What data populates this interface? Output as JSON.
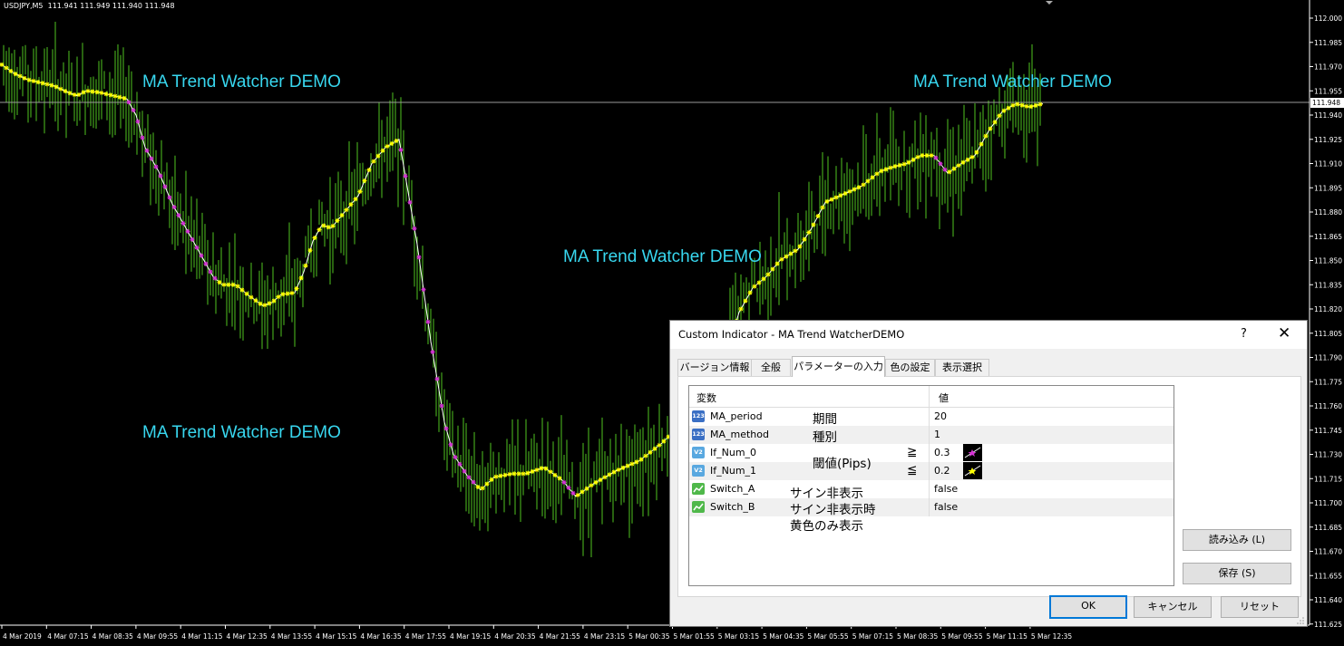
{
  "chart": {
    "symbol": "USDJPY,M5",
    "ohlc": "111.941 111.949 111.940 111.948",
    "current_price": "111.948",
    "price_ticks": [
      "112.000",
      "111.985",
      "111.970",
      "111.955",
      "111.940",
      "111.925",
      "111.910",
      "111.895",
      "111.880",
      "111.865",
      "111.850",
      "111.835",
      "111.820",
      "111.805",
      "111.790",
      "111.775",
      "111.760",
      "111.745",
      "111.730",
      "111.715",
      "111.700",
      "111.685",
      "111.670",
      "111.655",
      "111.640",
      "111.625"
    ],
    "time_ticks": [
      "4 Mar 2019",
      "4 Mar 07:15",
      "4 Mar 08:35",
      "4 Mar 09:55",
      "4 Mar 11:15",
      "4 Mar 12:35",
      "4 Mar 13:55",
      "4 Mar 15:15",
      "4 Mar 16:35",
      "4 Mar 17:55",
      "4 Mar 19:15",
      "4 Mar 20:35",
      "4 Mar 21:55",
      "4 Mar 23:15",
      "5 Mar 00:35",
      "5 Mar 01:55",
      "5 Mar 03:15",
      "5 Mar 04:35",
      "5 Mar 05:55",
      "5 Mar 07:15",
      "5 Mar 08:35",
      "5 Mar 09:55",
      "5 Mar 11:15",
      "5 Mar 12:35"
    ],
    "watermarks": [
      "MA Trend Watcher DEMO",
      "MA Trend Watcher DEMO",
      "MA Trend Watcher DEMO",
      "MA Trend Watcher DEMO"
    ],
    "colors": {
      "bars": "#4fc51f",
      "ma_line": "#ffffff",
      "ma_up_marker": "#ffff00",
      "ma_down_marker": "#d633d6",
      "watermark": "#38d7ef"
    },
    "ma_path": [
      [
        0,
        111.972
      ],
      [
        15,
        111.966
      ],
      [
        30,
        111.962
      ],
      [
        45,
        111.96
      ],
      [
        60,
        111.958
      ],
      [
        75,
        111.954
      ],
      [
        85,
        111.952
      ],
      [
        95,
        111.955
      ],
      [
        110,
        111.954
      ],
      [
        125,
        111.952
      ],
      [
        140,
        111.95
      ],
      [
        150,
        111.94
      ],
      [
        160,
        111.92
      ],
      [
        175,
        111.905
      ],
      [
        190,
        111.885
      ],
      [
        205,
        111.87
      ],
      [
        220,
        111.855
      ],
      [
        235,
        111.84
      ],
      [
        245,
        111.835
      ],
      [
        260,
        111.835
      ],
      [
        275,
        111.828
      ],
      [
        290,
        111.822
      ],
      [
        300,
        111.824
      ],
      [
        310,
        111.829
      ],
      [
        325,
        111.83
      ],
      [
        335,
        111.843
      ],
      [
        345,
        111.862
      ],
      [
        355,
        111.872
      ],
      [
        365,
        111.87
      ],
      [
        380,
        111.88
      ],
      [
        395,
        111.89
      ],
      [
        410,
        111.91
      ],
      [
        425,
        111.92
      ],
      [
        440,
        111.925
      ],
      [
        460,
        111.86
      ],
      [
        475,
        111.8
      ],
      [
        490,
        111.75
      ],
      [
        500,
        111.73
      ],
      [
        515,
        111.717
      ],
      [
        530,
        111.708
      ],
      [
        545,
        111.716
      ],
      [
        565,
        111.718
      ],
      [
        580,
        111.718
      ],
      [
        600,
        111.722
      ],
      [
        620,
        111.714
      ],
      [
        635,
        111.704
      ],
      [
        655,
        111.712
      ],
      [
        680,
        111.72
      ],
      [
        705,
        111.726
      ],
      [
        730,
        111.737
      ],
      [
        750,
        111.748
      ],
      [
        765,
        111.755
      ],
      [
        780,
        111.765
      ],
      [
        800,
        111.79
      ],
      [
        815,
        111.818
      ],
      [
        830,
        111.833
      ],
      [
        845,
        111.84
      ],
      [
        860,
        111.85
      ],
      [
        880,
        111.857
      ],
      [
        895,
        111.87
      ],
      [
        910,
        111.886
      ],
      [
        930,
        111.891
      ],
      [
        950,
        111.896
      ],
      [
        970,
        111.905
      ],
      [
        985,
        111.908
      ],
      [
        1000,
        111.91
      ],
      [
        1015,
        111.915
      ],
      [
        1030,
        111.915
      ],
      [
        1045,
        111.904
      ],
      [
        1060,
        111.91
      ],
      [
        1075,
        111.915
      ],
      [
        1090,
        111.93
      ],
      [
        1105,
        111.942
      ],
      [
        1120,
        111.947
      ],
      [
        1135,
        111.945
      ],
      [
        1150,
        111.947
      ]
    ]
  },
  "dialog": {
    "title": "Custom Indicator - MA Trend WatcherDEMO",
    "help": "?",
    "close": "✕",
    "tabs": [
      "バージョン情報",
      "全般",
      "パラメーターの入力",
      "色の設定",
      "表示選択"
    ],
    "columns": {
      "name": "変数",
      "value": "値"
    },
    "params": [
      {
        "name": "MA_period",
        "value": "20",
        "type": "int",
        "type_badge": "123"
      },
      {
        "name": "MA_method",
        "value": "1",
        "type": "int",
        "type_badge": "123"
      },
      {
        "name": "If_Num_0",
        "value": "0.3",
        "type": "double",
        "type_badge": "V2"
      },
      {
        "name": "If_Num_1",
        "value": "0.2",
        "type": "double",
        "type_badge": "V2"
      },
      {
        "name": "Switch_A",
        "value": "false",
        "type": "bool",
        "type_badge": ""
      },
      {
        "name": "Switch_B",
        "value": "false",
        "type": "bool",
        "type_badge": ""
      }
    ],
    "notes": {
      "period": "期間",
      "method": "種別",
      "threshold": "閾値(Pips)",
      "gte": "≧",
      "lte": "≦",
      "switch_a": "サイン非表示",
      "switch_b_1": "サイン非表示時",
      "switch_b_2": "黄色のみ表示"
    },
    "buttons": {
      "load": "読み込み (L)",
      "save": "保存 (S)",
      "ok": "OK",
      "cancel": "キャンセル",
      "reset": "リセット"
    }
  }
}
